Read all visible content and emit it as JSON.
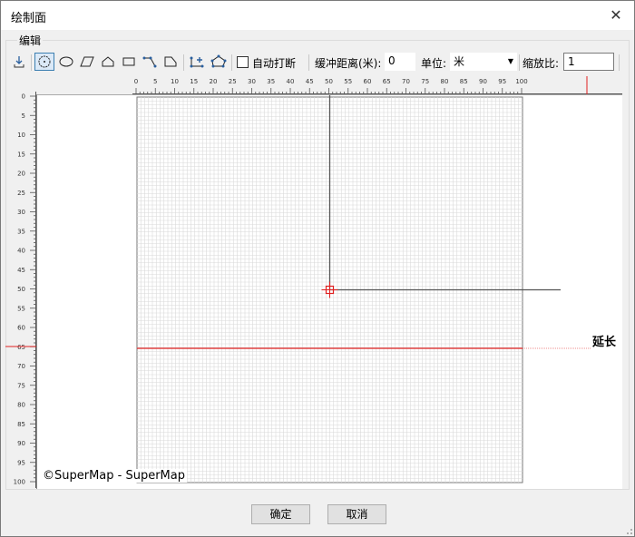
{
  "window": {
    "title": "绘制面",
    "close_icon": "close-icon"
  },
  "group": {
    "label": "编辑"
  },
  "toolbar": {
    "tools": [
      "import-icon",
      "circle-tool-icon",
      "ellipse-tool-icon",
      "parallelogram-tool-icon",
      "polygon-tool-icon",
      "rectangle-tool-icon",
      "polyline-tool-icon",
      "chamfer-tool-icon",
      "add-node-icon",
      "edit-node-icon"
    ],
    "selected_tool": "circle-tool-icon",
    "auto_break_label": "自动打断",
    "auto_break_checked": false,
    "buffer_label": "缓冲距离(米):",
    "buffer_value": "0",
    "unit_label": "单位:",
    "unit_value": "米",
    "scale_label": "缩放比:",
    "scale_value": "1"
  },
  "ruler": {
    "h_labels": [
      "0",
      "5",
      "10",
      "15",
      "20",
      "25",
      "30",
      "35",
      "40",
      "45",
      "50",
      "55",
      "60",
      "65",
      "70",
      "75",
      "80",
      "85",
      "90",
      "95",
      "100"
    ],
    "v_labels": [
      "0",
      "5",
      "10",
      "15",
      "20",
      "25",
      "30",
      "35",
      "40",
      "45",
      "50",
      "55",
      "60",
      "65",
      "70",
      "75",
      "80",
      "85",
      "90",
      "95",
      "100"
    ]
  },
  "canvas": {
    "watermark": "©SuperMap - SuperMap",
    "extend_label": "延长",
    "colors": {
      "grid": "#d9d9d9",
      "axis": "#555555",
      "accent": "#e02020"
    }
  },
  "buttons": {
    "ok": "确定",
    "cancel": "取消"
  }
}
